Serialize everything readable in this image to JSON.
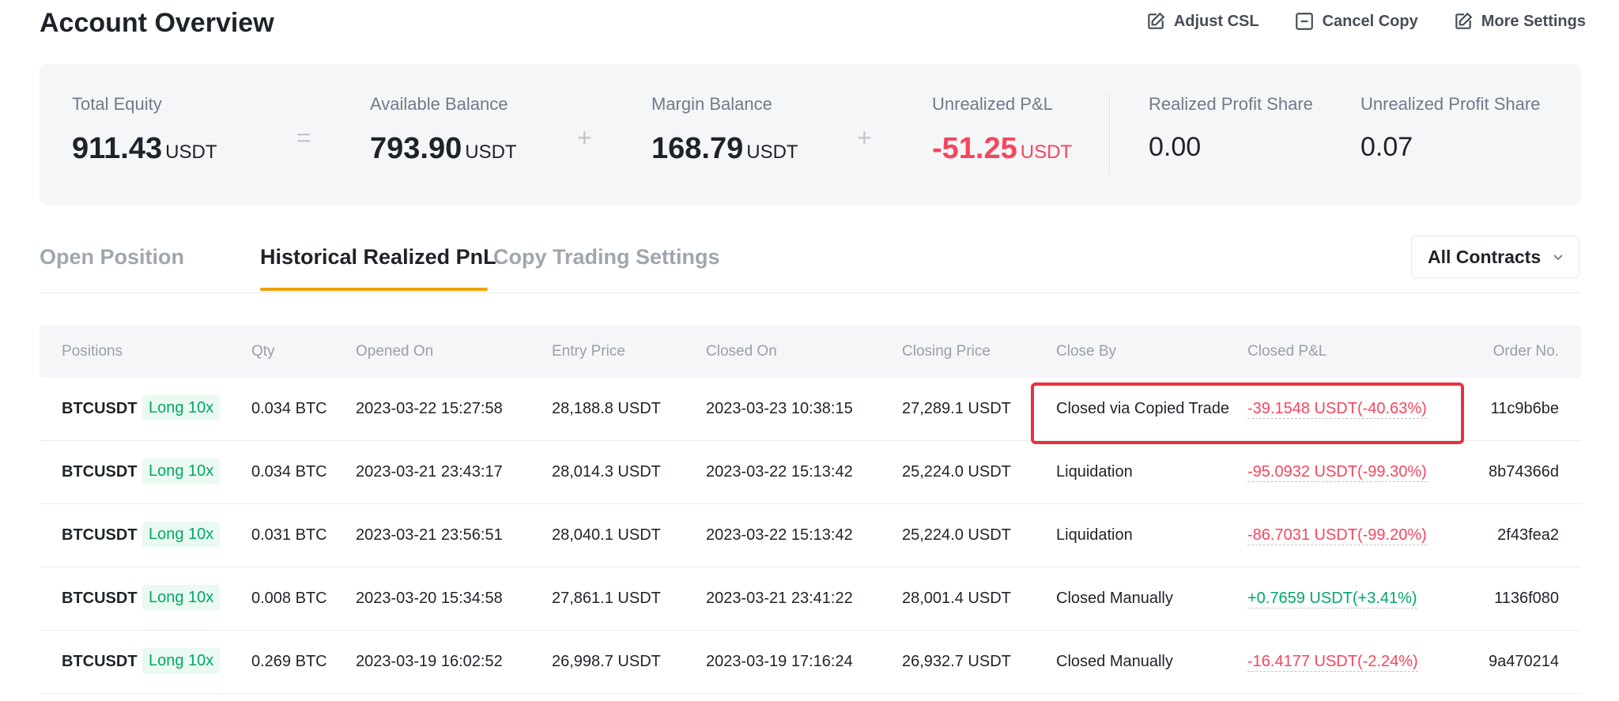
{
  "header": {
    "title": "Account Overview",
    "actions": [
      {
        "label": "Adjust CSL",
        "icon": "edit-icon"
      },
      {
        "label": "Cancel Copy",
        "icon": "minus-square-icon"
      },
      {
        "label": "More Settings",
        "icon": "edit-icon"
      }
    ]
  },
  "summary": {
    "total_equity": {
      "label": "Total Equity",
      "value": "911.43",
      "unit": "USDT"
    },
    "available_balance": {
      "label": "Available Balance",
      "value": "793.90",
      "unit": "USDT"
    },
    "margin_balance": {
      "label": "Margin Balance",
      "value": "168.79",
      "unit": "USDT"
    },
    "unrealized_pnl": {
      "label": "Unrealized P&L",
      "value": "-51.25",
      "unit": "USDT"
    },
    "realized_profit_share": {
      "label": "Realized Profit Share",
      "value": "0.00"
    },
    "unrealized_profit_share": {
      "label": "Unrealized Profit Share",
      "value": "0.07"
    },
    "operators": [
      "=",
      "+",
      "+"
    ]
  },
  "tabs": [
    {
      "label": "Open Position",
      "active": false
    },
    {
      "label": "Historical Realized PnL",
      "active": true
    },
    {
      "label": "Copy Trading Settings",
      "active": false
    }
  ],
  "filter": {
    "selected": "All Contracts"
  },
  "table": {
    "headers": [
      "Positions",
      "Qty",
      "Opened On",
      "Entry Price",
      "Closed On",
      "Closing Price",
      "Close By",
      "Closed P&L",
      "Order No."
    ],
    "rows": [
      {
        "symbol": "BTCUSDT",
        "side": "Long 10x",
        "qty": "0.034 BTC",
        "opened": "2023-03-22 15:27:58",
        "entry": "28,188.8 USDT",
        "closed": "2023-03-23 10:38:15",
        "closing": "27,289.1 USDT",
        "close_by": "Closed via Copied Trade",
        "pnl": "-39.1548 USDT(-40.63%)",
        "pnl_sign": "neg",
        "order": "11c9b6be"
      },
      {
        "symbol": "BTCUSDT",
        "side": "Long 10x",
        "qty": "0.034 BTC",
        "opened": "2023-03-21 23:43:17",
        "entry": "28,014.3 USDT",
        "closed": "2023-03-22 15:13:42",
        "closing": "25,224.0 USDT",
        "close_by": "Liquidation",
        "pnl": "-95.0932 USDT(-99.30%)",
        "pnl_sign": "neg",
        "order": "8b74366d"
      },
      {
        "symbol": "BTCUSDT",
        "side": "Long 10x",
        "qty": "0.031 BTC",
        "opened": "2023-03-21 23:56:51",
        "entry": "28,040.1 USDT",
        "closed": "2023-03-22 15:13:42",
        "closing": "25,224.0 USDT",
        "close_by": "Liquidation",
        "pnl": "-86.7031 USDT(-99.20%)",
        "pnl_sign": "neg",
        "order": "2f43fea2"
      },
      {
        "symbol": "BTCUSDT",
        "side": "Long 10x",
        "qty": "0.008 BTC",
        "opened": "2023-03-20 15:34:58",
        "entry": "27,861.1 USDT",
        "closed": "2023-03-21 23:41:22",
        "closing": "28,001.4 USDT",
        "close_by": "Closed Manually",
        "pnl": "+0.7659 USDT(+3.41%)",
        "pnl_sign": "pos",
        "order": "1136f080"
      },
      {
        "symbol": "BTCUSDT",
        "side": "Long 10x",
        "qty": "0.269 BTC",
        "opened": "2023-03-19 16:02:52",
        "entry": "26,998.7 USDT",
        "closed": "2023-03-19 17:16:24",
        "closing": "26,932.7 USDT",
        "close_by": "Closed Manually",
        "pnl": "-16.4177 USDT(-2.24%)",
        "pnl_sign": "neg",
        "order": "9a470214"
      }
    ]
  },
  "colors": {
    "negative": "#f6465d",
    "positive": "#03a66d",
    "accent": "#f0a20b",
    "highlight": "#e8323c"
  }
}
